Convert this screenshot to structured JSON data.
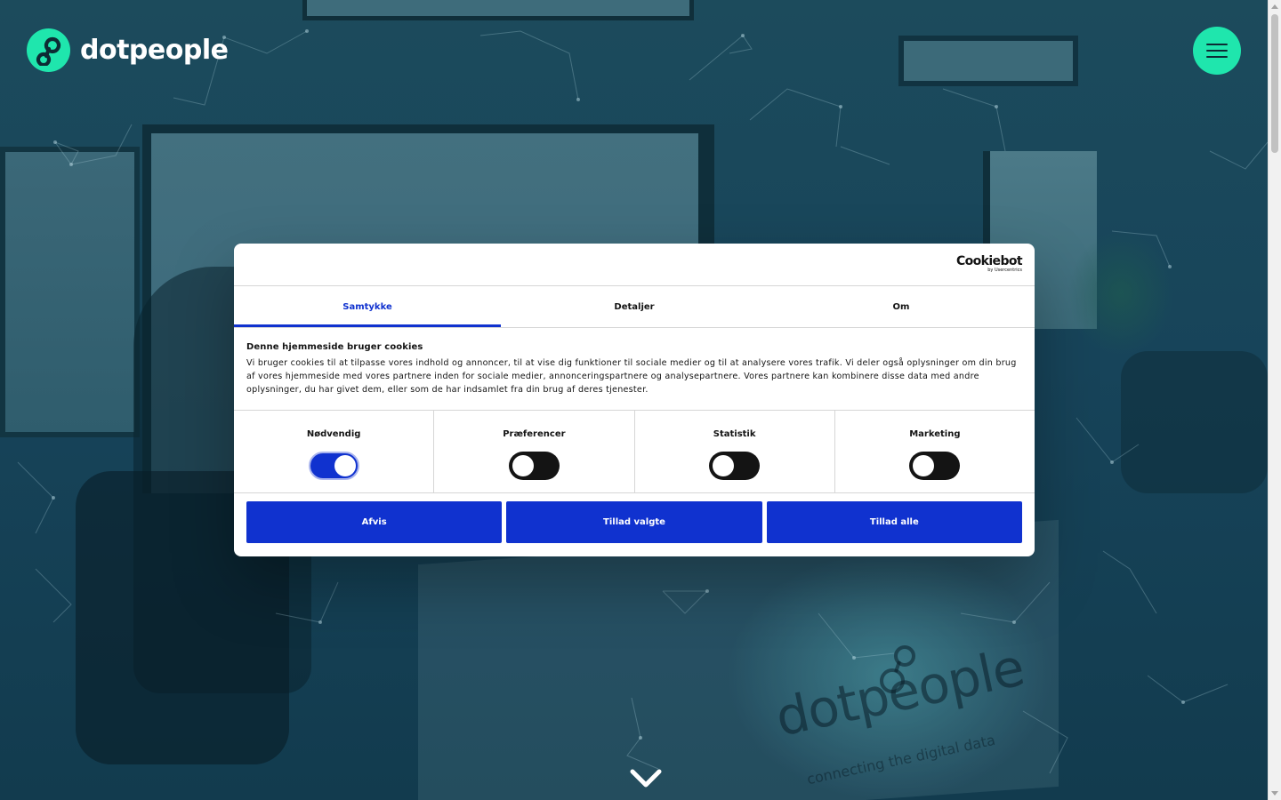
{
  "header": {
    "logo_text": "dotpeople",
    "menu_icon": "hamburger-icon",
    "accent_color": "#1fe6ad"
  },
  "hero": {
    "watermark_text": "dotpeople",
    "watermark_tagline": "connecting the digital data",
    "scroll_icon": "chevron-down-icon"
  },
  "cookie_dialog": {
    "brand": {
      "name": "Cookiebot",
      "byline": "by Usercentrics"
    },
    "tabs": [
      {
        "label": "Samtykke",
        "active": true
      },
      {
        "label": "Detaljer",
        "active": false
      },
      {
        "label": "Om",
        "active": false
      }
    ],
    "title": "Denne hjemmeside bruger cookies",
    "text": "Vi bruger cookies til at tilpasse vores indhold og annoncer, til at vise dig funktioner til sociale medier og til at analysere vores trafik. Vi deler også oplysninger om din brug af vores hjemmeside med vores partnere inden for sociale medier, annonceringspartnere og analysepartnere. Vores partnere kan kombinere disse data med andre oplysninger, du har givet dem, eller som de har indsamlet fra din brug af deres tjenester.",
    "toggles": [
      {
        "label": "Nødvendig",
        "checked": true
      },
      {
        "label": "Præferencer",
        "checked": false
      },
      {
        "label": "Statistik",
        "checked": false
      },
      {
        "label": "Marketing",
        "checked": false
      }
    ],
    "buttons": {
      "reject": "Afvis",
      "allow_selected": "Tillad valgte",
      "allow_all": "Tillad alle"
    },
    "accent_color": "#1032cf"
  }
}
